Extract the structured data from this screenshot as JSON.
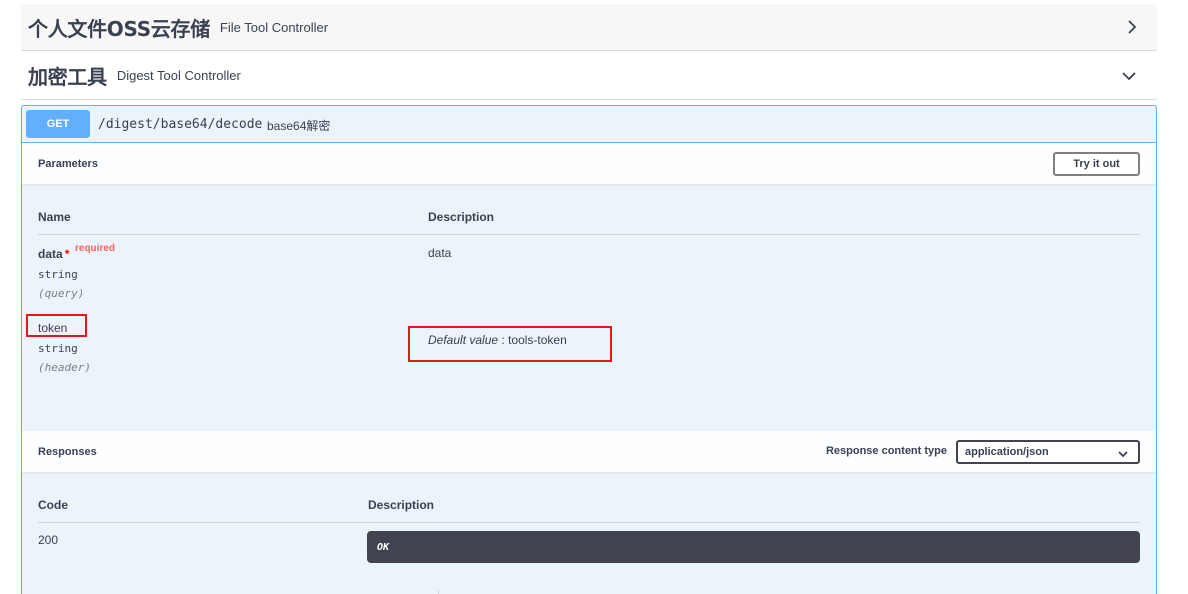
{
  "tags": [
    {
      "title": "个人文件OSS云存储",
      "description": "File Tool Controller",
      "expanded": false,
      "icon": "chevron-right-icon"
    },
    {
      "title": "加密工具",
      "description": "Digest Tool Controller",
      "expanded": true,
      "icon": "chevron-down-icon"
    }
  ],
  "operation": {
    "method": "GET",
    "path": "/digest/base64/decode",
    "summary": "base64解密",
    "method_color": "#61affe"
  },
  "parameters": {
    "section_title": "Parameters",
    "try_button": "Try it out",
    "col_name": "Name",
    "col_description": "Description",
    "items": [
      {
        "name": "data",
        "required_mark": "*",
        "required_label": "required",
        "type": "string",
        "in": "(query)",
        "description": "data"
      },
      {
        "name": "token",
        "type": "string",
        "in": "(header)",
        "default_label": "Default value",
        "default_separator": " : ",
        "default_value": "tools-token"
      }
    ]
  },
  "responses": {
    "section_title": "Responses",
    "content_type_label": "Response content type",
    "content_type_value": "application/json",
    "col_code": "Code",
    "col_description": "Description",
    "items": [
      {
        "code": "200",
        "description": "OK"
      }
    ]
  },
  "colors": {
    "highlight_red": "#e0191e",
    "required_red": "#ff0000",
    "dark_panel": "#41444e"
  }
}
